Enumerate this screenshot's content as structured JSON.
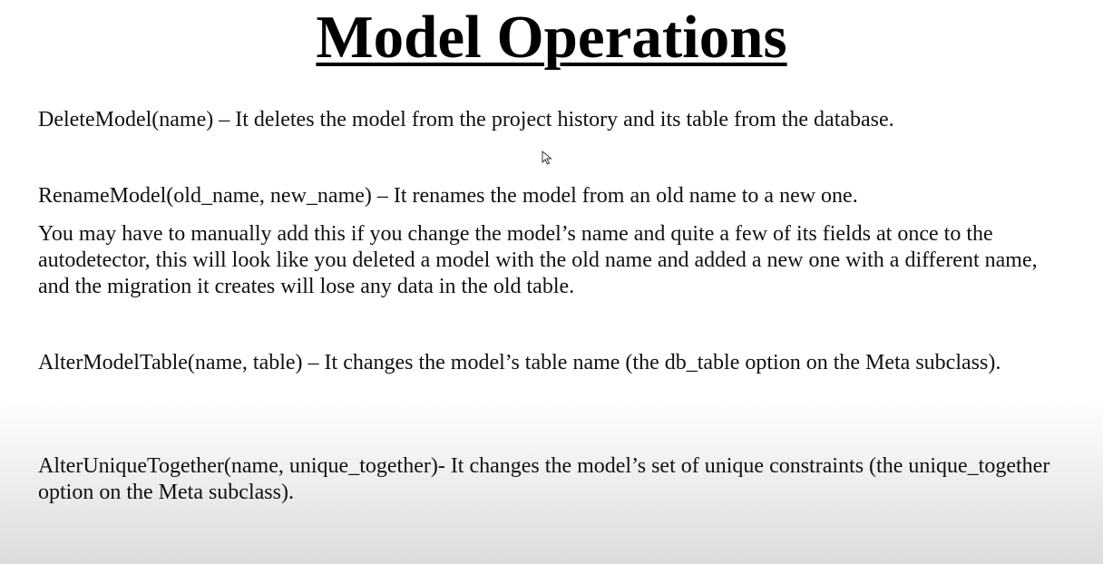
{
  "slide": {
    "title": "Model Operations",
    "paragraphs": {
      "delete_model": "DeleteModel(name) – It deletes the model from the project history and its table from the database.",
      "rename_model": "RenameModel(old_name, new_name) – It renames the model from an old name to a new one.",
      "rename_note": "You may have to manually add this if you change the model’s name and quite a few of its fields at once to the autodetector, this will look like you deleted a model with the old name and added a new one with a different name, and the migration it creates will lose any data in the old table.",
      "alter_model_table": "AlterModelTable(name, table) – It changes the model’s table name (the db_table option on the Meta subclass).",
      "alter_unique_together": "AlterUniqueTogether(name, unique_together)- It changes the model’s set of unique constraints (the unique_together option on the Meta subclass)."
    }
  },
  "icons": {
    "cursor": "mouse-pointer-icon"
  }
}
